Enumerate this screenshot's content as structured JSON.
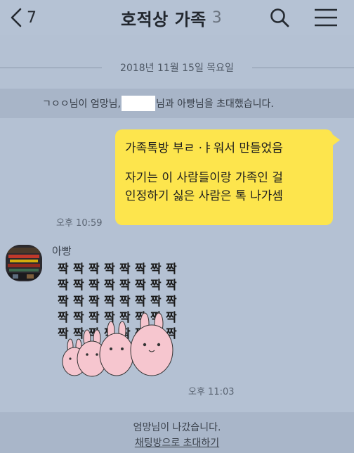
{
  "header": {
    "back_count": "7",
    "title": "호적상 가족",
    "member_count": "3",
    "search_icon": "search-icon",
    "menu_icon": "menu-icon"
  },
  "date_separator": "2018년 11월 15일 목요일",
  "system_invite": {
    "before": "ㄱㅇㅇ님이 엄망님,",
    "after": "님과 아빵님을 초대했습니다."
  },
  "message_mine": {
    "lines": [
      "가족톡방 부ㄹ ·ㅑ워서 만들었음",
      "",
      "자기는 이 사람들이랑 가족인 걸",
      "인정하기 싫은 사람은 톡 나가셈"
    ],
    "time": "오후 10:59",
    "color": "#fde54d"
  },
  "message_other": {
    "sender": "아빵",
    "sticker_text": "짝",
    "time": "오후 11:03"
  },
  "leave_notice": {
    "text": "엄망님이 나갔습니다.",
    "link": "채팅방으로 초대하기"
  }
}
